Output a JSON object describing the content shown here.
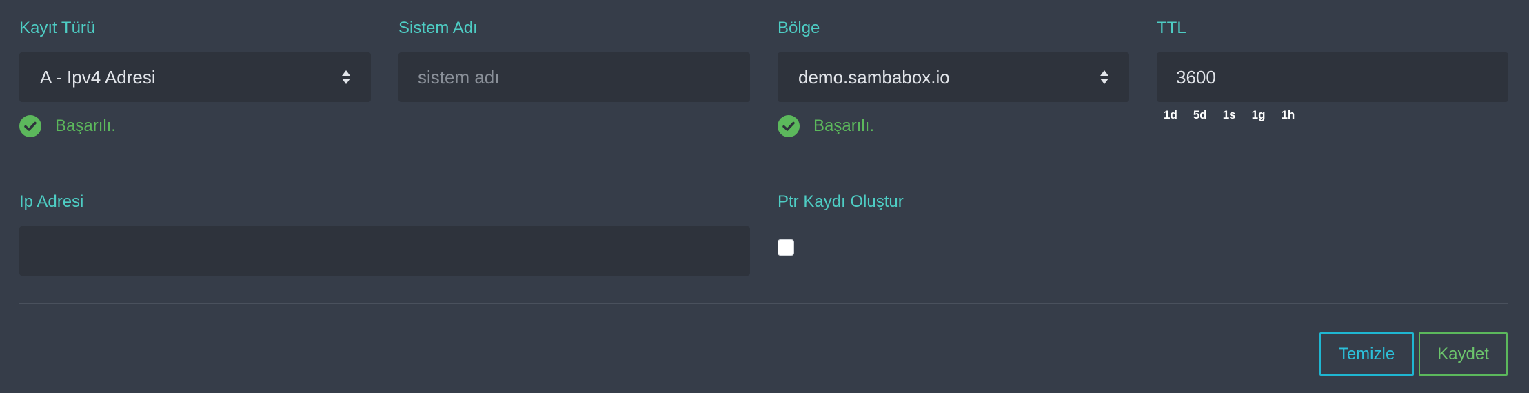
{
  "record_type": {
    "label": "Kayıt Türü",
    "value": "A - Ipv4 Adresi",
    "status": "Başarılı."
  },
  "system_name": {
    "label": "Sistem Adı",
    "placeholder": "sistem adı",
    "value": ""
  },
  "zone": {
    "label": "Bölge",
    "value": "demo.sambabox.io",
    "status": "Başarılı."
  },
  "ttl": {
    "label": "TTL",
    "value": "3600",
    "presets": [
      "1d",
      "5d",
      "1s",
      "1g",
      "1h"
    ]
  },
  "ip_address": {
    "label": "Ip Adresi",
    "value": ""
  },
  "ptr": {
    "label": "Ptr Kaydı Oluştur",
    "checked": false
  },
  "actions": {
    "clear_label": "Temizle",
    "save_label": "Kaydet"
  },
  "colors": {
    "background": "#363d49",
    "field_background": "#2e333c",
    "label_teal": "#4ecdc4",
    "success_green": "#5cb85c",
    "clear_button_border": "#1fb6d1"
  },
  "icons": {
    "select_arrows": "sort-arrows-icon",
    "success": "check-circle-icon"
  }
}
